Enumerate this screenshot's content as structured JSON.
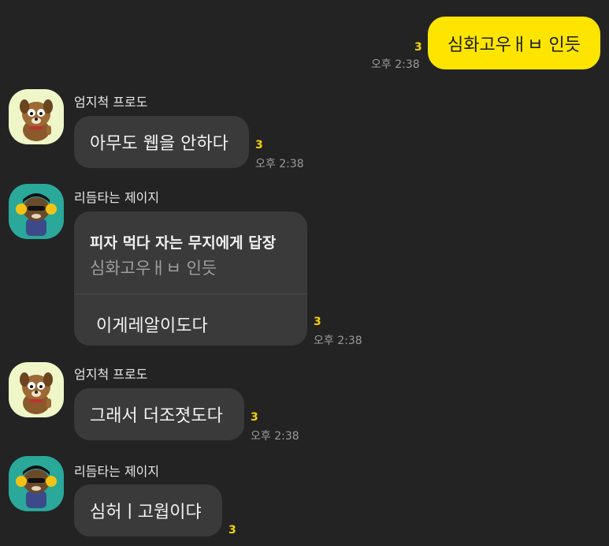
{
  "messages": [
    {
      "id": "m1",
      "direction": "out",
      "text": "심화고우ㅐㅂ 인듯",
      "unread": "3",
      "time": "오후 2:38"
    },
    {
      "id": "m2",
      "direction": "in",
      "sender": "엄지척 프로도",
      "avatar": "frodo-thumbs-up",
      "text": "아무도 웹을 안하다",
      "unread": "3",
      "time": "오후 2:38"
    },
    {
      "id": "m3",
      "direction": "in",
      "sender": "리듬타는 제이지",
      "avatar": "jayg-headphones",
      "reply": {
        "title": "피자 먹다 자는 무지에게 답장",
        "quote": "심화고우ㅐㅂ 인듯"
      },
      "text": "이게레알이도다",
      "unread": "3",
      "time": "오후 2:38"
    },
    {
      "id": "m4",
      "direction": "in",
      "sender": "엄지척 프로도",
      "avatar": "frodo-thumbs-up",
      "text": "그래서 더조졋도다",
      "unread": "3",
      "time": "오후 2:38"
    },
    {
      "id": "m5",
      "direction": "in",
      "sender": "리듬타는 제이지",
      "avatar": "jayg-headphones",
      "text": "심허ㅣ고웝이댜",
      "unread": "3"
    }
  ],
  "colors": {
    "background": "#232323",
    "outgoing_bubble": "#fee500",
    "incoming_bubble": "#3a3a3a",
    "unread_count": "#f5d200",
    "timestamp": "#9a9a9a"
  }
}
